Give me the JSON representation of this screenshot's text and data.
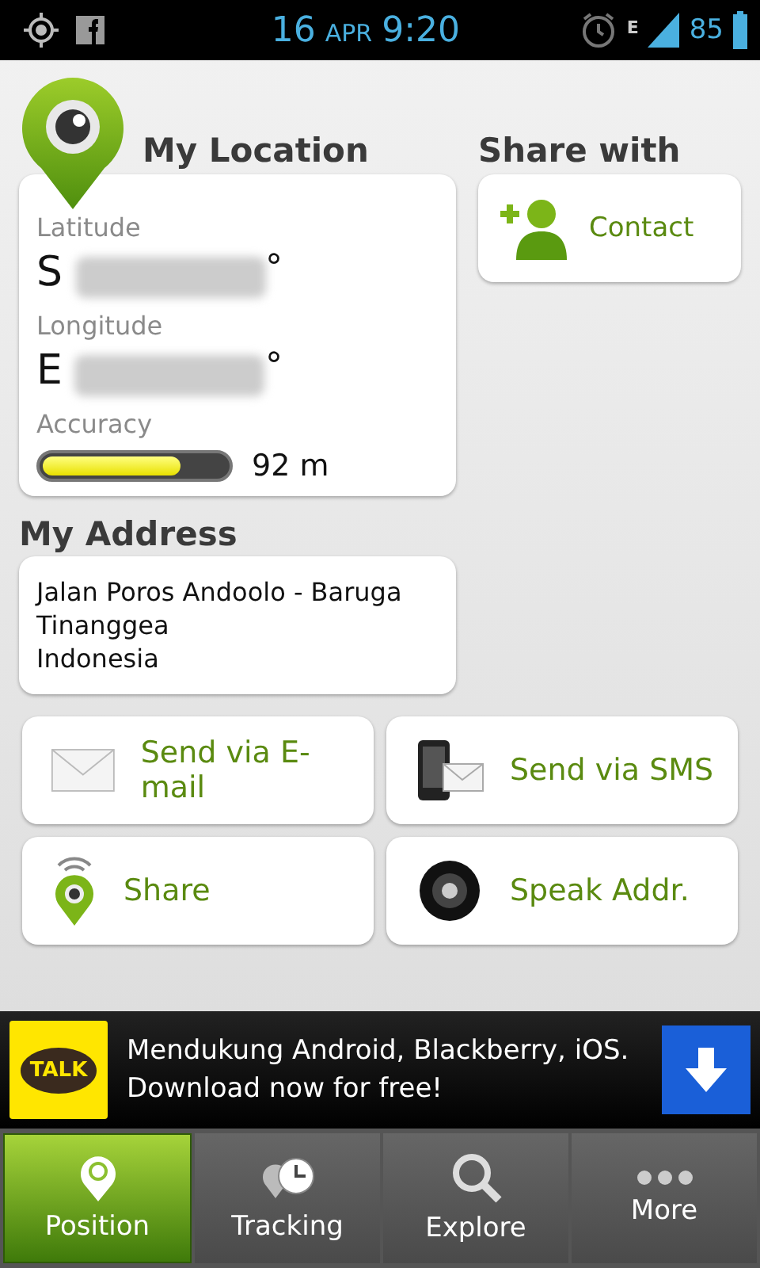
{
  "status_bar": {
    "day": "16",
    "month": "APR",
    "time": "9:20",
    "network": "E",
    "battery": "85"
  },
  "location": {
    "title": "My Location",
    "latitude_label": "Latitude",
    "latitude_hemisphere": "S",
    "latitude_unit": "°",
    "longitude_label": "Longitude",
    "longitude_hemisphere": "E",
    "longitude_unit": "°",
    "accuracy_label": "Accuracy",
    "accuracy": {
      "level": 0.75,
      "reading": "92 m"
    }
  },
  "share": {
    "title": "Share with",
    "contact": "Contact"
  },
  "address": {
    "title": "My Address",
    "lines": [
      "Jalan Poros Andoolo - Baruga",
      "Tinanggea",
      "Indonesia"
    ]
  },
  "actions": [
    {
      "kind": "mail",
      "label": "Send via E-mail"
    },
    {
      "kind": "sms",
      "label": "Send via SMS"
    },
    {
      "kind": "share",
      "label": "Share"
    },
    {
      "kind": "speak",
      "label": "Speak Addr."
    }
  ],
  "ad": {
    "logo": "TALK",
    "lines": [
      "Mendukung Android, Blackberry, iOS.",
      "Download now for free!"
    ]
  },
  "tabs": [
    {
      "kind": "position",
      "label": "Position",
      "selected": true
    },
    {
      "kind": "tracking",
      "label": "Tracking",
      "selected": false
    },
    {
      "kind": "explore",
      "label": "Explore",
      "selected": false
    },
    {
      "kind": "more",
      "label": "More",
      "selected": false
    }
  ]
}
